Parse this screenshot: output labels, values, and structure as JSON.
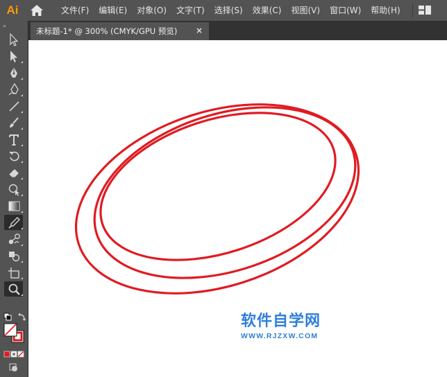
{
  "app": {
    "logo_text": "Ai",
    "menus": [
      {
        "label": "文件(F)",
        "name": "menu-file"
      },
      {
        "label": "编辑(E)",
        "name": "menu-edit"
      },
      {
        "label": "对象(O)",
        "name": "menu-object"
      },
      {
        "label": "文字(T)",
        "name": "menu-type"
      },
      {
        "label": "选择(S)",
        "name": "menu-select"
      },
      {
        "label": "效果(C)",
        "name": "menu-effect"
      },
      {
        "label": "视图(V)",
        "name": "menu-view"
      },
      {
        "label": "窗口(W)",
        "name": "menu-window"
      },
      {
        "label": "帮助(H)",
        "name": "menu-help"
      }
    ]
  },
  "toolbar": {
    "collapse_glyph": "»",
    "tools": [
      {
        "name": "selection-tool",
        "icon": "selection-arrow-icon",
        "active": false,
        "corner": false
      },
      {
        "name": "direct-selection-tool",
        "icon": "direct-selection-icon",
        "active": false,
        "corner": true
      },
      {
        "name": "pen-tool",
        "icon": "pen-icon",
        "active": false,
        "corner": true
      },
      {
        "name": "curvature-tool",
        "icon": "curvature-icon",
        "active": false,
        "corner": true
      },
      {
        "name": "line-segment-tool",
        "icon": "line-icon",
        "active": false,
        "corner": true
      },
      {
        "name": "paintbrush-tool",
        "icon": "brush-icon",
        "active": false,
        "corner": true
      },
      {
        "name": "type-tool",
        "icon": "type-icon",
        "active": false,
        "corner": true
      },
      {
        "name": "rotate-tool",
        "icon": "rotate-icon",
        "active": false,
        "corner": true
      },
      {
        "name": "eraser-tool",
        "icon": "eraser-icon",
        "active": false,
        "corner": true
      },
      {
        "name": "puppet-warp-tool",
        "icon": "puppet-warp-icon",
        "active": false,
        "corner": true
      },
      {
        "name": "gradient-tool",
        "icon": "gradient-icon",
        "active": false,
        "corner": true
      },
      {
        "name": "eyedropper-tool",
        "icon": "eyedropper-icon",
        "active": true,
        "corner": true
      },
      {
        "name": "blend-tool",
        "icon": "blend-icon",
        "active": false,
        "corner": true
      },
      {
        "name": "shape-builder-tool",
        "icon": "shape-builder-icon",
        "active": false,
        "corner": true
      },
      {
        "name": "artboard-tool",
        "icon": "artboard-icon",
        "active": false,
        "corner": true
      },
      {
        "name": "zoom-tool",
        "icon": "zoom-icon",
        "active": true,
        "corner": true
      }
    ],
    "fill_color": "none",
    "stroke_color": "#d81e1e"
  },
  "document": {
    "tab_title": "未标题-1* @ 300% (CMYK/GPU 预览)",
    "close_glyph": "×",
    "zoom": "300%",
    "color_mode": "CMYK/GPU 预览"
  },
  "artwork": {
    "stroke_color": "#e01b22",
    "ring_count": 3
  },
  "watermark": {
    "title": "软件自学网",
    "url": "WWW.RJZXW.COM",
    "color": "#2f7fd9"
  }
}
